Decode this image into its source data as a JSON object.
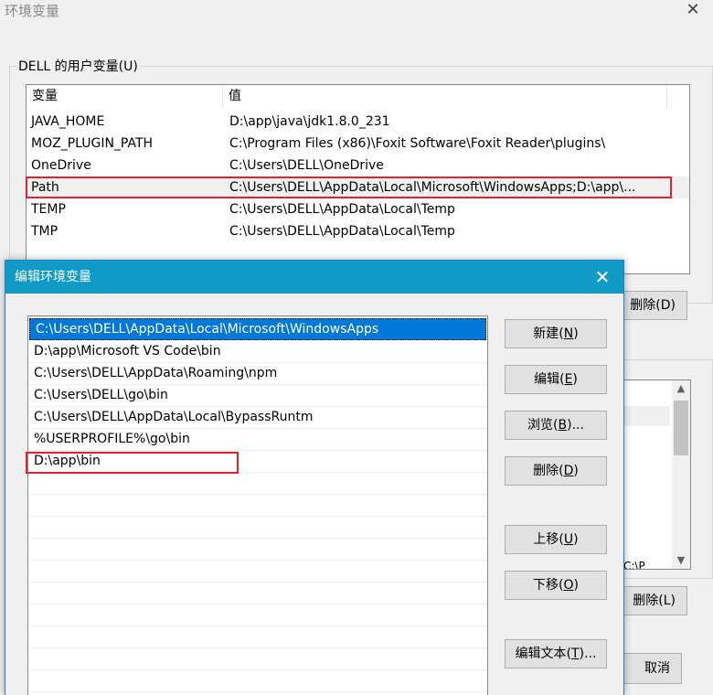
{
  "bg_window": {
    "title": "环境变量",
    "close_glyph": "✕",
    "user_group_label": "DELL 的用户变量(U)",
    "columns": [
      "变量",
      "值"
    ],
    "user_vars": [
      {
        "name": "JAVA_HOME",
        "value": "D:\\app\\java\\jdk1.8.0_231"
      },
      {
        "name": "MOZ_PLUGIN_PATH",
        "value": "C:\\Program Files (x86)\\Foxit Software\\Foxit Reader\\plugins\\"
      },
      {
        "name": "OneDrive",
        "value": "C:\\Users\\DELL\\OneDrive"
      },
      {
        "name": "Path",
        "value": "C:\\Users\\DELL\\AppData\\Local\\Microsoft\\WindowsApps;D:\\app\\..."
      },
      {
        "name": "TEMP",
        "value": "C:\\Users\\DELL\\AppData\\Local\\Temp"
      },
      {
        "name": "TMP",
        "value": "C:\\Users\\DELL\\AppData\\Local\\Temp"
      }
    ],
    "delete_user_partial": "删除(D)",
    "sys_cut_text": "C:\\P",
    "delete_sys_partial": "删除(L)",
    "cancel_partial": "取消",
    "scroll_up_glyph": "▲",
    "scroll_down_glyph": "▼"
  },
  "edit_dialog": {
    "title": "编辑环境变量",
    "close_glyph": "✕",
    "paths": [
      "C:\\Users\\DELL\\AppData\\Local\\Microsoft\\WindowsApps",
      "D:\\app\\Microsoft VS Code\\bin",
      "C:\\Users\\DELL\\AppData\\Roaming\\npm",
      "C:\\Users\\DELL\\go\\bin",
      "C:\\Users\\DELL\\AppData\\Local\\BypassRuntm",
      "%USERPROFILE%\\go\\bin",
      "D:\\app\\bin"
    ],
    "buttons": {
      "new": {
        "label": "新建",
        "key": "N"
      },
      "edit": {
        "label": "编辑",
        "key": "E"
      },
      "browse": {
        "label": "浏览",
        "key": "B",
        "suffix": "..."
      },
      "delete": {
        "label": "删除",
        "key": "D"
      },
      "move_up": {
        "label": "上移",
        "key": "U"
      },
      "move_down": {
        "label": "下移",
        "key": "O"
      },
      "edit_text": {
        "label": "编辑文本",
        "key": "T",
        "suffix": "..."
      }
    }
  },
  "colors": {
    "titlebar": "#0f9bc6",
    "selection": "#0078d7",
    "highlight_box": "#e0242d"
  }
}
